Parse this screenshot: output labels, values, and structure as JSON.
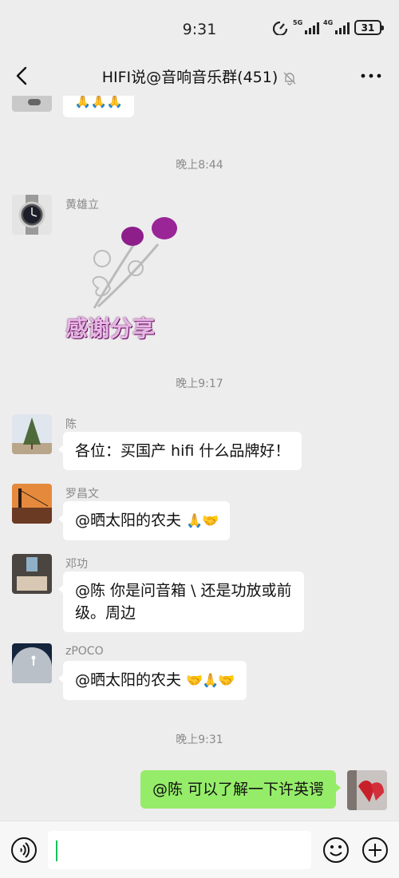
{
  "status": {
    "time": "9:31",
    "net1": "5G",
    "net2": "4G",
    "battery": "31"
  },
  "header": {
    "title": "HIFI说@音响音乐群(451)"
  },
  "messages": {
    "partial_emoji": "🙏🙏🙏",
    "ts1": "晚上8:44",
    "m1_sender": "黄雄立",
    "sticker_text": "感谢分享",
    "ts2": "晚上9:17",
    "m2_sender": "陈",
    "m2_text": "各位：买国产 hifi 什么品牌好！",
    "m3_sender": "罗昌文",
    "m3_text": "@晒太阳的农夫 ",
    "m3_emoji": "🙏🤝",
    "m4_sender": "邓功",
    "m4_line1": "@陈  你是问音箱 \\ 还是功放或前",
    "m4_line2": "级。周边",
    "m5_sender": "zPOCO",
    "m5_text": "@晒太阳的农夫 ",
    "m5_emoji": "🤝🙏🤝",
    "ts3": "晚上9:31",
    "m6_text": "@陈  可以了解一下许英谔"
  },
  "colors": {
    "bg": "#ededed",
    "my_bubble": "#95ec69",
    "caret": "#07c160"
  },
  "icons": [
    "back-arrow-icon",
    "mute-bell-icon",
    "more-icon",
    "voice-icon",
    "emoji-icon",
    "plus-icon"
  ]
}
